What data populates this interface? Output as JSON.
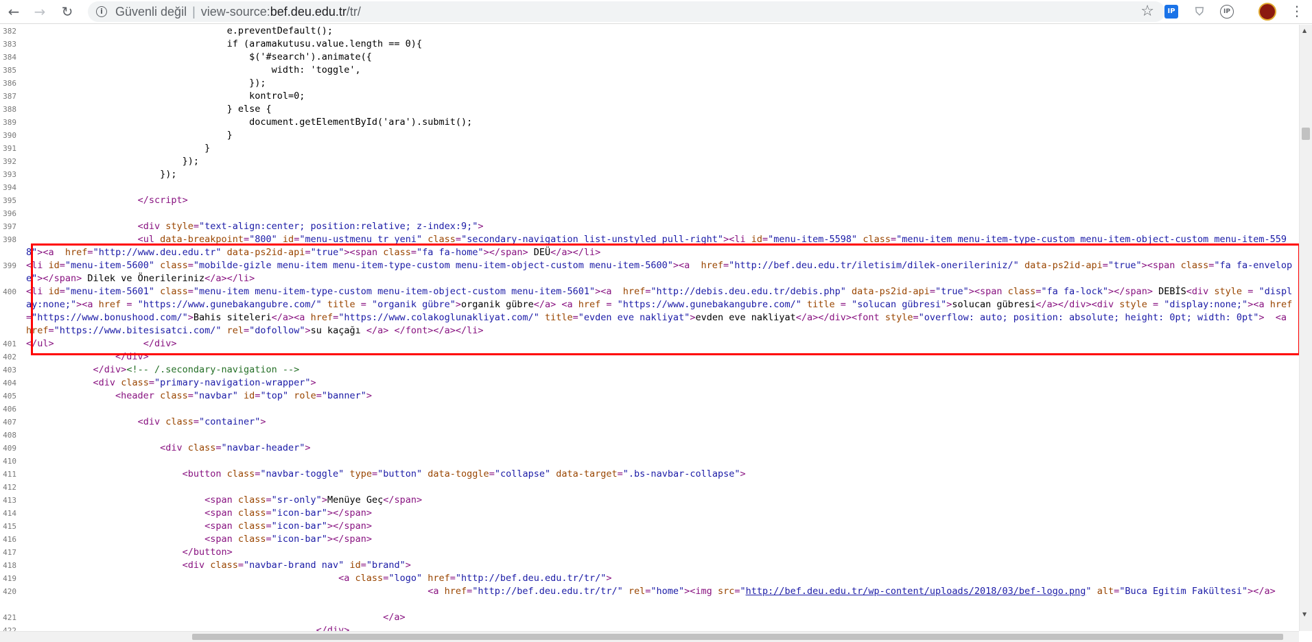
{
  "browser": {
    "security_label": "Güvenli değil",
    "url_prefix": "view-source:",
    "url_host": "bef.deu.edu.tr",
    "url_path": "/tr/",
    "extensions": [
      {
        "name": "ip-extension",
        "text": "IP",
        "color": "#1a73e8"
      },
      {
        "name": "shield-extension",
        "text": "",
        "color": "#9aa0a6"
      },
      {
        "name": "ip-lookup-extension",
        "text": "IP",
        "color": "#5f6368"
      }
    ]
  },
  "lines": [
    {
      "n": "382",
      "html": "                                    e.preventDefault();"
    },
    {
      "n": "383",
      "html": "                                    if (aramakutusu.value.length == 0){"
    },
    {
      "n": "384",
      "html": "                                        $('#search').animate({"
    },
    {
      "n": "385",
      "html": "                                            width: 'toggle',"
    },
    {
      "n": "386",
      "html": "                                        });"
    },
    {
      "n": "387",
      "html": "                                        kontrol=0;"
    },
    {
      "n": "388",
      "html": "                                    } else {"
    },
    {
      "n": "389",
      "html": "                                        document.getElementById('ara').submit();"
    },
    {
      "n": "390",
      "html": "                                    }"
    },
    {
      "n": "391",
      "html": "                                }"
    },
    {
      "n": "392",
      "html": "                            });"
    },
    {
      "n": "393",
      "html": "                        });"
    },
    {
      "n": "394",
      "html": ""
    },
    {
      "n": "395",
      "html": "                    <span class=\"tag\">&lt;/script&gt;</span>"
    },
    {
      "n": "396",
      "html": ""
    },
    {
      "n": "397",
      "html": "                    <span class=\"tag\">&lt;div </span><span class=\"attr\">style</span><span class=\"tag\">=</span><span class=\"val\">\"text-align:center; position:relative; z-index:9;\"</span><span class=\"tag\">&gt;</span>"
    },
    {
      "n": "398",
      "html": "                    <span class=\"tag\">&lt;ul </span><span class=\"attr\">data-breakpoint</span><span class=\"tag\">=</span><span class=\"val\">\"800\"</span><span class=\"tag\"> </span><span class=\"attr\">id</span><span class=\"tag\">=</span><span class=\"val\">\"menu-ustmenu_tr_yeni\"</span><span class=\"tag\"> </span><span class=\"attr\">class</span><span class=\"tag\">=</span><span class=\"val\">\"secondary-navigation list-unstyled pull-right\"</span><span class=\"tag\">&gt;&lt;li </span><span class=\"attr\">id</span><span class=\"tag\">=</span><span class=\"val\">\"menu-item-5598\"</span><span class=\"tag\"> </span><span class=\"attr\">class</span><span class=\"tag\">=</span><span class=\"val\">\"menu-item menu-item-type-custom menu-item-object-custom menu-item-5598\"</span><span class=\"tag\">&gt;&lt;a  </span><span class=\"attr\">href</span><span class=\"tag\">=</span><span class=\"val\">\"http://www.deu.edu.tr\"</span><span class=\"tag\"> </span><span class=\"attr\">data-ps2id-api</span><span class=\"tag\">=</span><span class=\"val\">\"true\"</span><span class=\"tag\">&gt;&lt;span </span><span class=\"attr\">class</span><span class=\"tag\">=</span><span class=\"val\">\"fa fa-home\"</span><span class=\"tag\">&gt;&lt;/span&gt;</span> DEÜ<span class=\"tag\">&lt;/a&gt;&lt;/li&gt;</span>"
    },
    {
      "n": "399",
      "html": "<span class=\"tag\">&lt;li </span><span class=\"attr\">id</span><span class=\"tag\">=</span><span class=\"val\">\"menu-item-5600\"</span><span class=\"tag\"> </span><span class=\"attr\">class</span><span class=\"tag\">=</span><span class=\"val\">\"mobilde-gizle menu-item menu-item-type-custom menu-item-object-custom menu-item-5600\"</span><span class=\"tag\">&gt;&lt;a  </span><span class=\"attr\">href</span><span class=\"tag\">=</span><span class=\"val\">\"http://bef.deu.edu.tr/iletisim/dilek-onerileriniz/\"</span><span class=\"tag\"> </span><span class=\"attr\">data-ps2id-api</span><span class=\"tag\">=</span><span class=\"val\">\"true\"</span><span class=\"tag\">&gt;&lt;span </span><span class=\"attr\">class</span><span class=\"tag\">=</span><span class=\"val\">\"fa fa-envelope\"</span><span class=\"tag\">&gt;&lt;/span&gt;</span> Dilek ve Önerileriniz<span class=\"tag\">&lt;/a&gt;&lt;/li&gt;</span>"
    },
    {
      "n": "400",
      "html": "<span class=\"tag\">&lt;li </span><span class=\"attr\">id</span><span class=\"tag\">=</span><span class=\"val\">\"menu-item-5601\"</span><span class=\"tag\"> </span><span class=\"attr\">class</span><span class=\"tag\">=</span><span class=\"val\">\"menu-item menu-item-type-custom menu-item-object-custom menu-item-5601\"</span><span class=\"tag\">&gt;&lt;a  </span><span class=\"attr\">href</span><span class=\"tag\">=</span><span class=\"val\">\"http://debis.deu.edu.tr/debis.php\"</span><span class=\"tag\"> </span><span class=\"attr\">data-ps2id-api</span><span class=\"tag\">=</span><span class=\"val\">\"true\"</span><span class=\"tag\">&gt;&lt;span </span><span class=\"attr\">class</span><span class=\"tag\">=</span><span class=\"val\">\"fa fa-lock\"</span><span class=\"tag\">&gt;&lt;/span&gt;</span> DEBİS<span class=\"tag\">&lt;div </span><span class=\"attr\">style </span><span class=\"tag\">= </span><span class=\"val\">\"display:none;\"</span><span class=\"tag\">&gt;&lt;a </span><span class=\"attr\">href </span><span class=\"tag\">= </span><span class=\"val\">\"https://www.gunebakangubre.com/\"</span><span class=\"tag\"> </span><span class=\"attr\">title </span><span class=\"tag\">= </span><span class=\"val\">\"organik gübre\"</span><span class=\"tag\">&gt;</span>organik gübre<span class=\"tag\">&lt;/a&gt; &lt;a </span><span class=\"attr\">href </span><span class=\"tag\">= </span><span class=\"val\">\"https://www.gunebakangubre.com/\"</span><span class=\"tag\"> </span><span class=\"attr\">title </span><span class=\"tag\">= </span><span class=\"val\">\"solucan gübresi\"</span><span class=\"tag\">&gt;</span>solucan gübresi<span class=\"tag\">&lt;/a&gt;&lt;/div&gt;&lt;div </span><span class=\"attr\">style </span><span class=\"tag\">= </span><span class=\"val\">\"display:none;\"</span><span class=\"tag\">&gt;&lt;a </span><span class=\"attr\">href</span><span class=\"tag\">=</span><span class=\"val\">\"https://www.bonushood.com/\"</span><span class=\"tag\">&gt;</span>Bahis siteleri<span class=\"tag\">&lt;/a&gt;&lt;a </span><span class=\"attr\">href</span><span class=\"tag\">=</span><span class=\"val\">\"https://www.colakoglunakliyat.com/\"</span><span class=\"tag\"> </span><span class=\"attr\">title</span><span class=\"tag\">=</span><span class=\"val\">\"evden eve nakliyat\"</span><span class=\"tag\">&gt;</span>evden eve nakliyat<span class=\"tag\">&lt;/a&gt;&lt;/div&gt;&lt;font </span><span class=\"attr\">style</span><span class=\"tag\">=</span><span class=\"val\">\"overflow: auto; position: absolute; height: 0pt; width: 0pt\"</span><span class=\"tag\">&gt;  &lt;a </span><span class=\"attr\">href</span><span class=\"tag\">=</span><span class=\"val\">\"https://www.bitesisatci.com/\"</span><span class=\"tag\"> </span><span class=\"attr\">rel</span><span class=\"tag\">=</span><span class=\"val\">\"dofollow\"</span><span class=\"tag\">&gt;</span>su kaçağı <span class=\"tag\">&lt;/a&gt; &lt;/font&gt;&lt;/a&gt;&lt;/li&gt;</span>"
    },
    {
      "n": "401",
      "html": "<span class=\"tag\">&lt;/ul&gt;</span>                <span class=\"tag\">&lt;/div&gt;</span>"
    },
    {
      "n": "402",
      "html": "                <span class=\"tag\">&lt;/div&gt;</span>"
    },
    {
      "n": "403",
      "html": "            <span class=\"tag\">&lt;/div&gt;</span><span class=\"cmt\">&lt;!-- /.secondary-navigation --&gt;</span>"
    },
    {
      "n": "404",
      "html": "            <span class=\"tag\">&lt;div </span><span class=\"attr\">class</span><span class=\"tag\">=</span><span class=\"val\">\"primary-navigation-wrapper\"</span><span class=\"tag\">&gt;</span>"
    },
    {
      "n": "405",
      "html": "                <span class=\"tag\">&lt;header </span><span class=\"attr\">class</span><span class=\"tag\">=</span><span class=\"val\">\"navbar\"</span><span class=\"tag\"> </span><span class=\"attr\">id</span><span class=\"tag\">=</span><span class=\"val\">\"top\"</span><span class=\"tag\"> </span><span class=\"attr\">role</span><span class=\"tag\">=</span><span class=\"val\">\"banner\"</span><span class=\"tag\">&gt;</span>"
    },
    {
      "n": "406",
      "html": ""
    },
    {
      "n": "407",
      "html": "                    <span class=\"tag\">&lt;div </span><span class=\"attr\">class</span><span class=\"tag\">=</span><span class=\"val\">\"container\"</span><span class=\"tag\">&gt;</span>"
    },
    {
      "n": "408",
      "html": ""
    },
    {
      "n": "409",
      "html": "                        <span class=\"tag\">&lt;div </span><span class=\"attr\">class</span><span class=\"tag\">=</span><span class=\"val\">\"navbar-header\"</span><span class=\"tag\">&gt;</span>"
    },
    {
      "n": "410",
      "html": ""
    },
    {
      "n": "411",
      "html": "                            <span class=\"tag\">&lt;button </span><span class=\"attr\">class</span><span class=\"tag\">=</span><span class=\"val\">\"navbar-toggle\"</span><span class=\"tag\"> </span><span class=\"attr\">type</span><span class=\"tag\">=</span><span class=\"val\">\"button\"</span><span class=\"tag\"> </span><span class=\"attr\">data-toggle</span><span class=\"tag\">=</span><span class=\"val\">\"collapse\"</span><span class=\"tag\"> </span><span class=\"attr\">data-target</span><span class=\"tag\">=</span><span class=\"val\">\".bs-navbar-collapse\"</span><span class=\"tag\">&gt;</span>"
    },
    {
      "n": "412",
      "html": ""
    },
    {
      "n": "413",
      "html": "                                <span class=\"tag\">&lt;span </span><span class=\"attr\">class</span><span class=\"tag\">=</span><span class=\"val\">\"sr-only\"</span><span class=\"tag\">&gt;</span>Menüye Geç<span class=\"tag\">&lt;/span&gt;</span>"
    },
    {
      "n": "414",
      "html": "                                <span class=\"tag\">&lt;span </span><span class=\"attr\">class</span><span class=\"tag\">=</span><span class=\"val\">\"icon-bar\"</span><span class=\"tag\">&gt;&lt;/span&gt;</span>"
    },
    {
      "n": "415",
      "html": "                                <span class=\"tag\">&lt;span </span><span class=\"attr\">class</span><span class=\"tag\">=</span><span class=\"val\">\"icon-bar\"</span><span class=\"tag\">&gt;&lt;/span&gt;</span>"
    },
    {
      "n": "416",
      "html": "                                <span class=\"tag\">&lt;span </span><span class=\"attr\">class</span><span class=\"tag\">=</span><span class=\"val\">\"icon-bar\"</span><span class=\"tag\">&gt;&lt;/span&gt;</span>"
    },
    {
      "n": "417",
      "html": "                            <span class=\"tag\">&lt;/button&gt;</span>"
    },
    {
      "n": "418",
      "html": "                            <span class=\"tag\">&lt;div </span><span class=\"attr\">class</span><span class=\"tag\">=</span><span class=\"val\">\"navbar-brand nav\"</span><span class=\"tag\"> </span><span class=\"attr\">id</span><span class=\"tag\">=</span><span class=\"val\">\"brand\"</span><span class=\"tag\">&gt;</span>"
    },
    {
      "n": "419",
      "html": "                                                        <span class=\"tag\">&lt;a </span><span class=\"attr\">class</span><span class=\"tag\">=</span><span class=\"val\">\"logo\"</span><span class=\"tag\"> </span><span class=\"attr\">href</span><span class=\"tag\">=</span><span class=\"val\">\"http://bef.deu.edu.tr/tr/\"</span><span class=\"tag\">&gt;</span>"
    },
    {
      "n": "420",
      "html": "                                                                        <span class=\"tag\">&lt;a </span><span class=\"attr\">href</span><span class=\"tag\">=</span><span class=\"val\">\"http://bef.deu.edu.tr/tr/\"</span><span class=\"tag\"> </span><span class=\"attr\">rel</span><span class=\"tag\">=</span><span class=\"val\">\"home\"</span><span class=\"tag\">&gt;&lt;img </span><span class=\"attr\">src</span><span class=\"tag\">=</span><span class=\"val\">\"</span><span class=\"lnk\">http://bef.deu.edu.tr/wp-content/uploads/2018/03/bef-logo.png</span><span class=\"val\">\"</span><span class=\"tag\"> </span><span class=\"attr\">alt</span><span class=\"tag\">=</span><span class=\"val\">\"Buca Egitim Fakültesi\"</span><span class=\"tag\">&gt;&lt;/a&gt;</span>"
    },
    {
      "n": "421",
      "html": "                                                                <span class=\"tag\">&lt;/a&gt;</span>"
    },
    {
      "n": "422",
      "html": "                                                    <span class=\"tag\">&lt;/div&gt;</span>"
    }
  ]
}
